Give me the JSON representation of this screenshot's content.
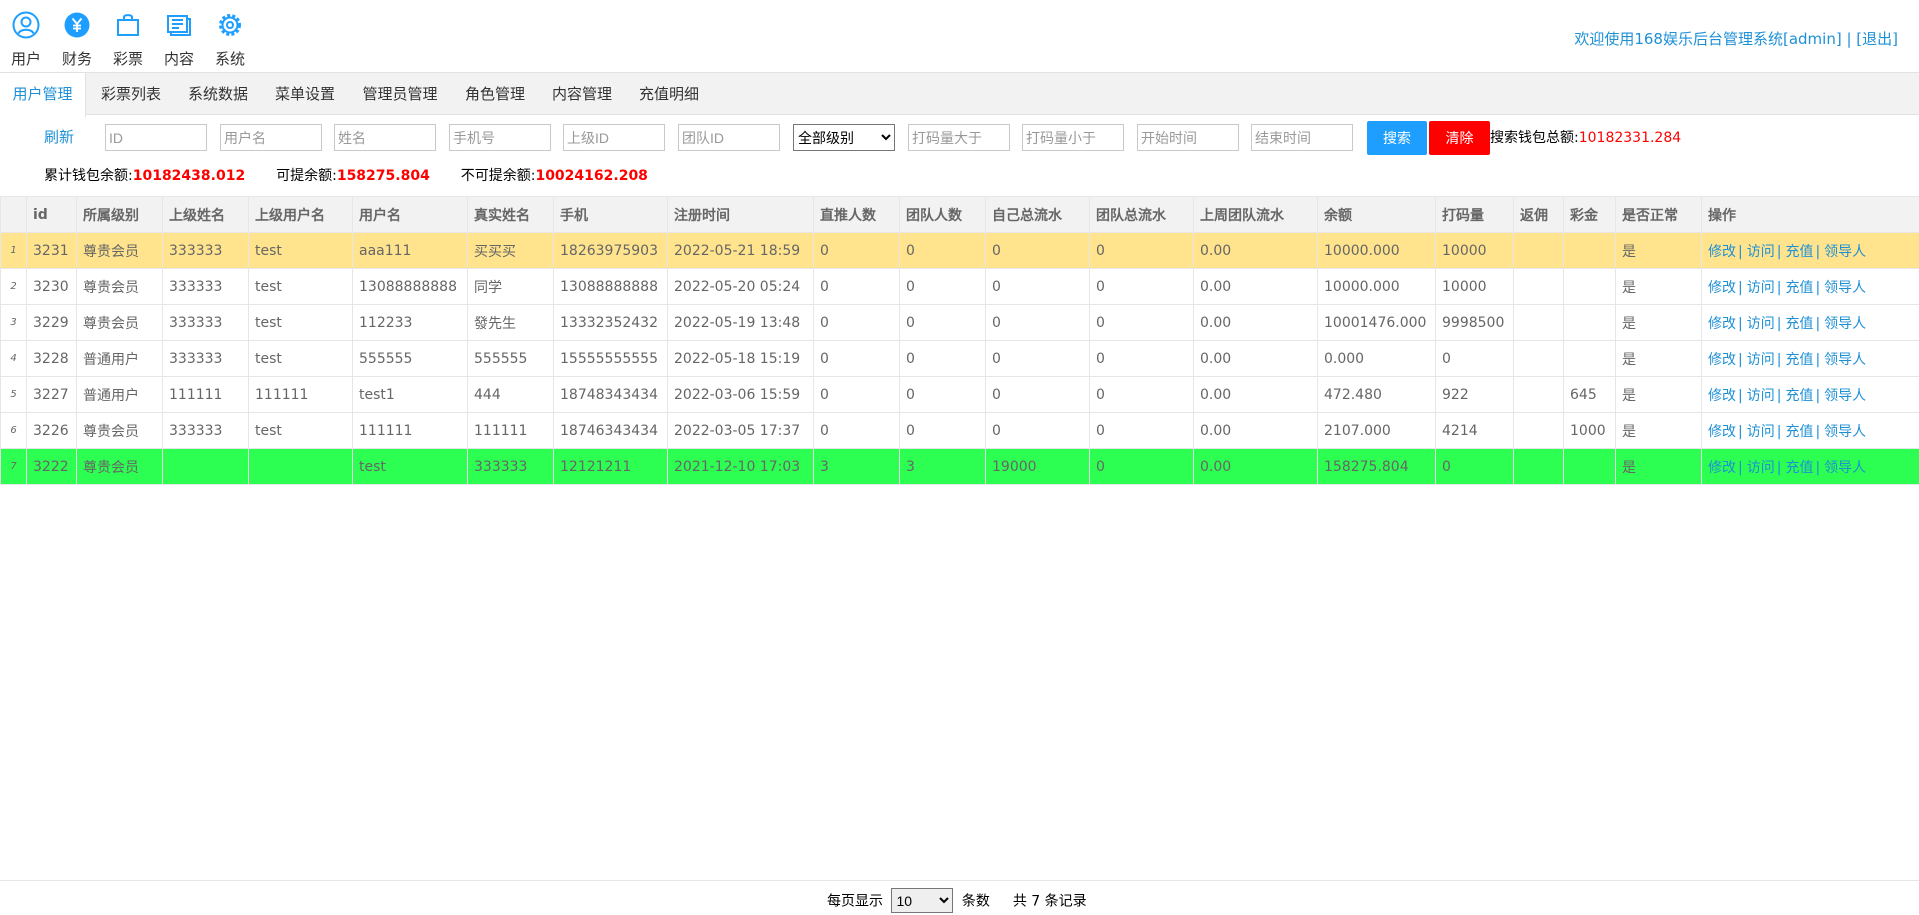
{
  "nav": {
    "items": [
      {
        "label": "用户",
        "icon": "user-icon"
      },
      {
        "label": "财务",
        "icon": "yuan-icon"
      },
      {
        "label": "彩票",
        "icon": "bag-icon"
      },
      {
        "label": "内容",
        "icon": "content-icon"
      },
      {
        "label": "系统",
        "icon": "gear-icon"
      }
    ],
    "welcome": "欢迎使用168娱乐后台管理系统[admin]",
    "separator": " | ",
    "logout": "[退出]"
  },
  "tabs": [
    "用户管理",
    "彩票列表",
    "系统数据",
    "菜单设置",
    "管理员管理",
    "角色管理",
    "内容管理",
    "充值明细"
  ],
  "filter": {
    "refresh": "刷新",
    "placeholders": {
      "id": "ID",
      "username": "用户名",
      "realname": "姓名",
      "phone": "手机号",
      "parent_id": "上级ID",
      "team_id": "团队ID",
      "bet_min": "打码量大于",
      "bet_max": "打码量小于",
      "start_time": "开始时间",
      "end_time": "结束时间"
    },
    "level_selected": "全部级别",
    "search_button": "搜索",
    "clear_button": "清除",
    "search_total_label": "搜索钱包总额:",
    "search_total_value": "10182331.284"
  },
  "stats": {
    "wallet_label": "累计钱包余额:",
    "wallet_value": "10182438.012",
    "withdrawable_label": "可提余额:",
    "withdrawable_value": "158275.804",
    "nonwithdrawable_label": "不可提余额:",
    "nonwithdrawable_value": "10024162.208"
  },
  "table": {
    "headers": [
      "id",
      "所属级别",
      "上级姓名",
      "上级用户名",
      "用户名",
      "真实姓名",
      "手机",
      "注册时间",
      "直推人数",
      "团队人数",
      "自己总流水",
      "团队总流水",
      "上周团队流水",
      "余额",
      "打码量",
      "返佣",
      "彩金",
      "是否正常",
      "操作"
    ],
    "actions": [
      "修改",
      "访问",
      "充值",
      "领导人"
    ],
    "rows": [
      {
        "n": "1",
        "cells": [
          "3231",
          "尊贵会员",
          "333333",
          "test",
          "aaa111",
          "买买买",
          "18263975903",
          "2022-05-21 18:59",
          "0",
          "0",
          "0",
          "0",
          "0.00",
          "10000.000",
          "10000",
          "",
          "",
          "是"
        ]
      },
      {
        "n": "2",
        "cells": [
          "3230",
          "尊贵会员",
          "333333",
          "test",
          "13088888888",
          "同学",
          "13088888888",
          "2022-05-20 05:24",
          "0",
          "0",
          "0",
          "0",
          "0.00",
          "10000.000",
          "10000",
          "",
          "",
          "是"
        ]
      },
      {
        "n": "3",
        "cells": [
          "3229",
          "尊贵会员",
          "333333",
          "test",
          "112233",
          "發先生",
          "13332352432",
          "2022-05-19 13:48",
          "0",
          "0",
          "0",
          "0",
          "0.00",
          "10001476.000",
          "9998500",
          "",
          "",
          "是"
        ]
      },
      {
        "n": "4",
        "cells": [
          "3228",
          "普通用户",
          "333333",
          "test",
          "555555",
          "555555",
          "15555555555",
          "2022-05-18 15:19",
          "0",
          "0",
          "0",
          "0",
          "0.00",
          "0.000",
          "0",
          "",
          "",
          "是"
        ]
      },
      {
        "n": "5",
        "cells": [
          "3227",
          "普通用户",
          "111111",
          "111111",
          "test1",
          "444",
          "18748343434",
          "2022-03-06 15:59",
          "0",
          "0",
          "0",
          "0",
          "0.00",
          "472.480",
          "922",
          "",
          "645",
          "是"
        ]
      },
      {
        "n": "6",
        "cells": [
          "3226",
          "尊贵会员",
          "333333",
          "test",
          "111111",
          "111111",
          "18746343434",
          "2022-03-05 17:37",
          "0",
          "0",
          "0",
          "0",
          "0.00",
          "2107.000",
          "4214",
          "",
          "1000",
          "是"
        ]
      },
      {
        "n": "7",
        "cells": [
          "3222",
          "尊贵会员",
          "",
          "",
          "test",
          "333333",
          "12121211",
          "2021-12-10 17:03",
          "3",
          "3",
          "19000",
          "0",
          "0.00",
          "158275.804",
          "0",
          "",
          "",
          "是"
        ]
      }
    ]
  },
  "pager": {
    "per_page_label": "每页显示",
    "per_page_value": "10",
    "unit": "条数",
    "total": "共 7 条记录"
  },
  "colors": {
    "accent": "#1e90d6",
    "search_button": "#1e9fff",
    "clear_button": "#ff0000",
    "highlight_row": "#ffe48d",
    "active_row": "#2dff52"
  }
}
